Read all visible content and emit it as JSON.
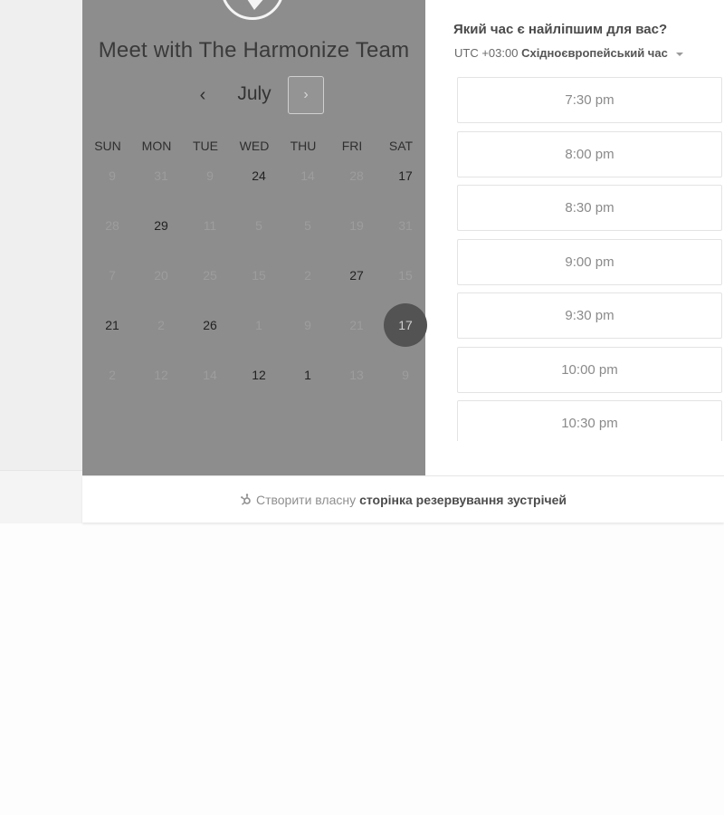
{
  "header": {
    "title": "Meet with The Harmonize Team"
  },
  "calendar": {
    "month": "July",
    "prev_icon": "‹",
    "next_icon": "›",
    "weekdays": [
      "SUN",
      "MON",
      "TUE",
      "WED",
      "THU",
      "FRI",
      "SAT"
    ],
    "days": [
      {
        "label": "9",
        "state": "disabled"
      },
      {
        "label": "31",
        "state": "disabled"
      },
      {
        "label": "9",
        "state": "disabled"
      },
      {
        "label": "24",
        "state": "available"
      },
      {
        "label": "14",
        "state": "disabled"
      },
      {
        "label": "28",
        "state": "disabled"
      },
      {
        "label": "17",
        "state": "available"
      },
      {
        "label": "28",
        "state": "disabled"
      },
      {
        "label": "29",
        "state": "available"
      },
      {
        "label": "11",
        "state": "disabled"
      },
      {
        "label": "5",
        "state": "disabled"
      },
      {
        "label": "5",
        "state": "disabled"
      },
      {
        "label": "19",
        "state": "disabled"
      },
      {
        "label": "31",
        "state": "disabled"
      },
      {
        "label": "7",
        "state": "disabled"
      },
      {
        "label": "20",
        "state": "disabled"
      },
      {
        "label": "25",
        "state": "disabled"
      },
      {
        "label": "15",
        "state": "disabled"
      },
      {
        "label": "2",
        "state": "disabled"
      },
      {
        "label": "27",
        "state": "available"
      },
      {
        "label": "15",
        "state": "disabled"
      },
      {
        "label": "21",
        "state": "available"
      },
      {
        "label": "2",
        "state": "disabled"
      },
      {
        "label": "26",
        "state": "available"
      },
      {
        "label": "1",
        "state": "disabled"
      },
      {
        "label": "9",
        "state": "disabled"
      },
      {
        "label": "21",
        "state": "disabled"
      },
      {
        "label": "17",
        "state": "selected"
      },
      {
        "label": "2",
        "state": "disabled"
      },
      {
        "label": "12",
        "state": "disabled"
      },
      {
        "label": "14",
        "state": "disabled"
      },
      {
        "label": "12",
        "state": "available"
      },
      {
        "label": "1",
        "state": "available"
      },
      {
        "label": "13",
        "state": "disabled"
      },
      {
        "label": "9",
        "state": "disabled"
      }
    ]
  },
  "times": {
    "question": "Який час є найліпшим для вас?",
    "tz_offset": "UTC +03:00",
    "tz_name": "Східноєвропейський час",
    "slots": [
      "7:30 pm",
      "8:00 pm",
      "8:30 pm",
      "9:00 pm",
      "9:30 pm",
      "10:00 pm",
      "10:30 pm"
    ]
  },
  "footer": {
    "prefix": "Створити власну",
    "link": "сторінка резервування зустрічей"
  }
}
